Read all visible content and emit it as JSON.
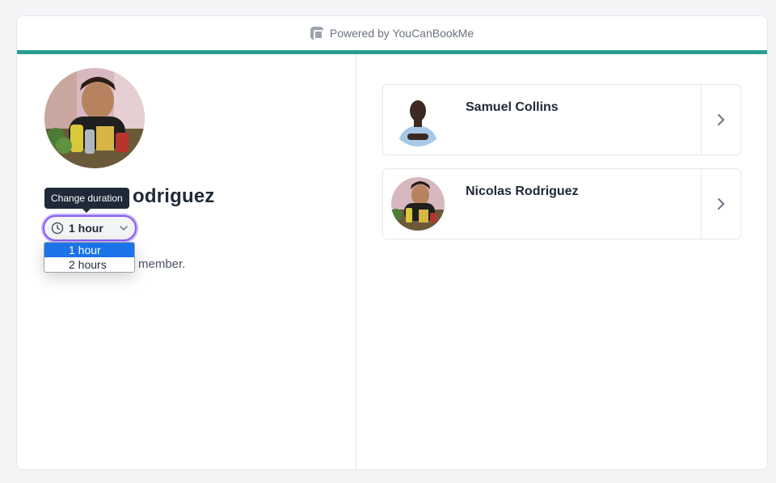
{
  "header": {
    "powered_by": "Powered by YouCanBookMe"
  },
  "colors": {
    "accent": "#2a9d8f",
    "focus_ring": "#8b5cf6",
    "selected_option": "#1a73e8"
  },
  "profile": {
    "name_visible": "odriguez",
    "description_visible": "member."
  },
  "duration": {
    "tooltip": "Change duration",
    "current_value": "1 hour",
    "options": [
      "1 hour",
      "2 hours"
    ]
  },
  "members": [
    {
      "name": "Samuel Collins",
      "icon": "chevron-right-icon"
    },
    {
      "name": "Nicolas Rodriguez",
      "icon": "chevron-right-icon"
    }
  ]
}
